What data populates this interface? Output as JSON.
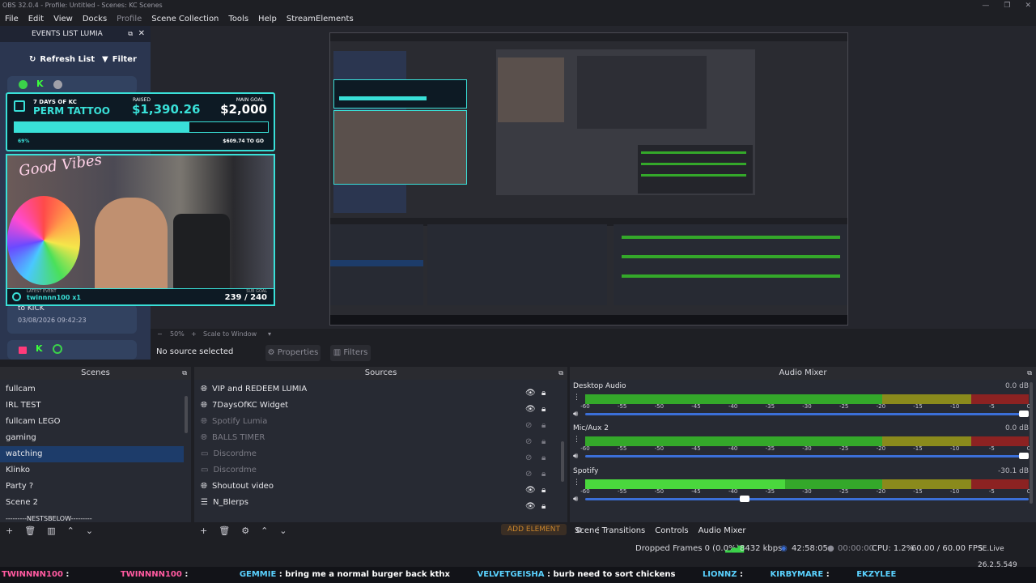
{
  "app": {
    "title": "OBS 32.0.4 - Profile: Untitled - Scenes: KC Scenes",
    "window_controls": [
      "—",
      "❐",
      "✕"
    ]
  },
  "menu": [
    "File",
    "Edit",
    "View",
    "Docks",
    "Profile",
    "Scene Collection",
    "Tools",
    "Help",
    "StreamElements"
  ],
  "events_dock": {
    "title": "EVENTS LIST LUMIA",
    "refresh_label": "Refresh List",
    "filter_label": "Filter",
    "partial_event_text": "to KICK",
    "partial_event_time": "03/08/2026 09:42:23"
  },
  "goal_overlay": {
    "top_label": "7 DAYS OF KC",
    "title": "PERM TATTOO",
    "raised_label": "RAISED",
    "raised_value": "$1,390.26",
    "goal_label": "MAIN GOAL",
    "goal_value": "$2,000",
    "progress_fraction": 0.69,
    "percent_text": "69%",
    "remaining_text": "$609.74 TO GO"
  },
  "cam_overlay": {
    "brand_text": "Good Vibes",
    "latest_label": "LATEST EVENT",
    "latest_value": "twinnnn100 x1",
    "sub_goal_label": "SUB GOAL",
    "sub_goal_value": "239 / 240"
  },
  "preview": {
    "zoom": "50%",
    "scale_mode": "Scale to Window"
  },
  "context_bar": {
    "no_source": "No source selected",
    "properties": "Properties",
    "filters": "Filters"
  },
  "scenes": {
    "title": "Scenes",
    "items": [
      "fullcam",
      "IRL TEST",
      "fullcam LEGO",
      "gaming",
      "watching",
      "Klinko",
      "Party ?",
      "Scene 2",
      "---------NESTSBELOW---------"
    ],
    "selected_index": 4
  },
  "sources": {
    "title": "Sources",
    "items": [
      {
        "label": "VIP and REDEEM LUMIA",
        "visible": true
      },
      {
        "label": "7DaysOfKC Widget",
        "visible": true
      },
      {
        "label": "Spotify Lumia",
        "visible": false
      },
      {
        "label": "BALLS TIMER",
        "visible": false
      },
      {
        "label": "Discordme",
        "visible": false
      },
      {
        "label": "Discordme",
        "visible": false
      },
      {
        "label": "Shoutout video",
        "visible": true
      },
      {
        "label": "N_Blerps",
        "visible": true
      }
    ],
    "add_element_label": "ADD ELEMENT"
  },
  "audio_mixer": {
    "title": "Audio Mixer",
    "ticks": [
      "-60",
      "-55",
      "-50",
      "-45",
      "-40",
      "-35",
      "-30",
      "-25",
      "-20",
      "-15",
      "-10",
      "-5",
      "0"
    ],
    "channels": [
      {
        "name": "Desktop Audio",
        "db": "0.0 dB",
        "level": 0.0,
        "volume": 1.0
      },
      {
        "name": "Mic/Aux 2",
        "db": "0.0 dB",
        "level": 0.0,
        "volume": 1.0
      },
      {
        "name": "Spotify",
        "db": "-30.1 dB",
        "level": 0.45,
        "volume": 0.37
      }
    ],
    "tabs": [
      "Scene Transitions",
      "Controls",
      "Audio Mixer"
    ]
  },
  "status": {
    "dropped_frames": "Dropped Frames 0 (0.0%)",
    "bitrate": "8432 kbps",
    "stream_time": "42:58:05",
    "rec_time": "00:00:00",
    "cpu": "CPU: 1.2%",
    "fps": "60.00 / 60.00 FPS",
    "se_live": "SE.Live 26.2.5.549"
  },
  "ticker": [
    {
      "name": "TWINNNN100",
      "msg": ""
    },
    {
      "name": "TWINNNN100",
      "msg": ""
    },
    {
      "name": "GEMMIE",
      "msg": "bring me a normal burger back kthx"
    },
    {
      "name": "VELVETGEISHA",
      "msg": "burb need to sort chickens"
    },
    {
      "name": "LIONNZ",
      "msg": ""
    },
    {
      "name": "KIRBYMARE",
      "msg": ""
    },
    {
      "name": "EKZYLEE",
      "msg": ""
    }
  ],
  "colors": {
    "accent_teal": "#39e0d8",
    "lumia_bg": "#2b3650",
    "selection": "#1d3c6a",
    "meter_green": "#34a82a",
    "meter_yellow": "#8a8a1c",
    "meter_red": "#8c2222",
    "fader_blue": "#3b6fd8",
    "add_element": "#c9852c"
  }
}
